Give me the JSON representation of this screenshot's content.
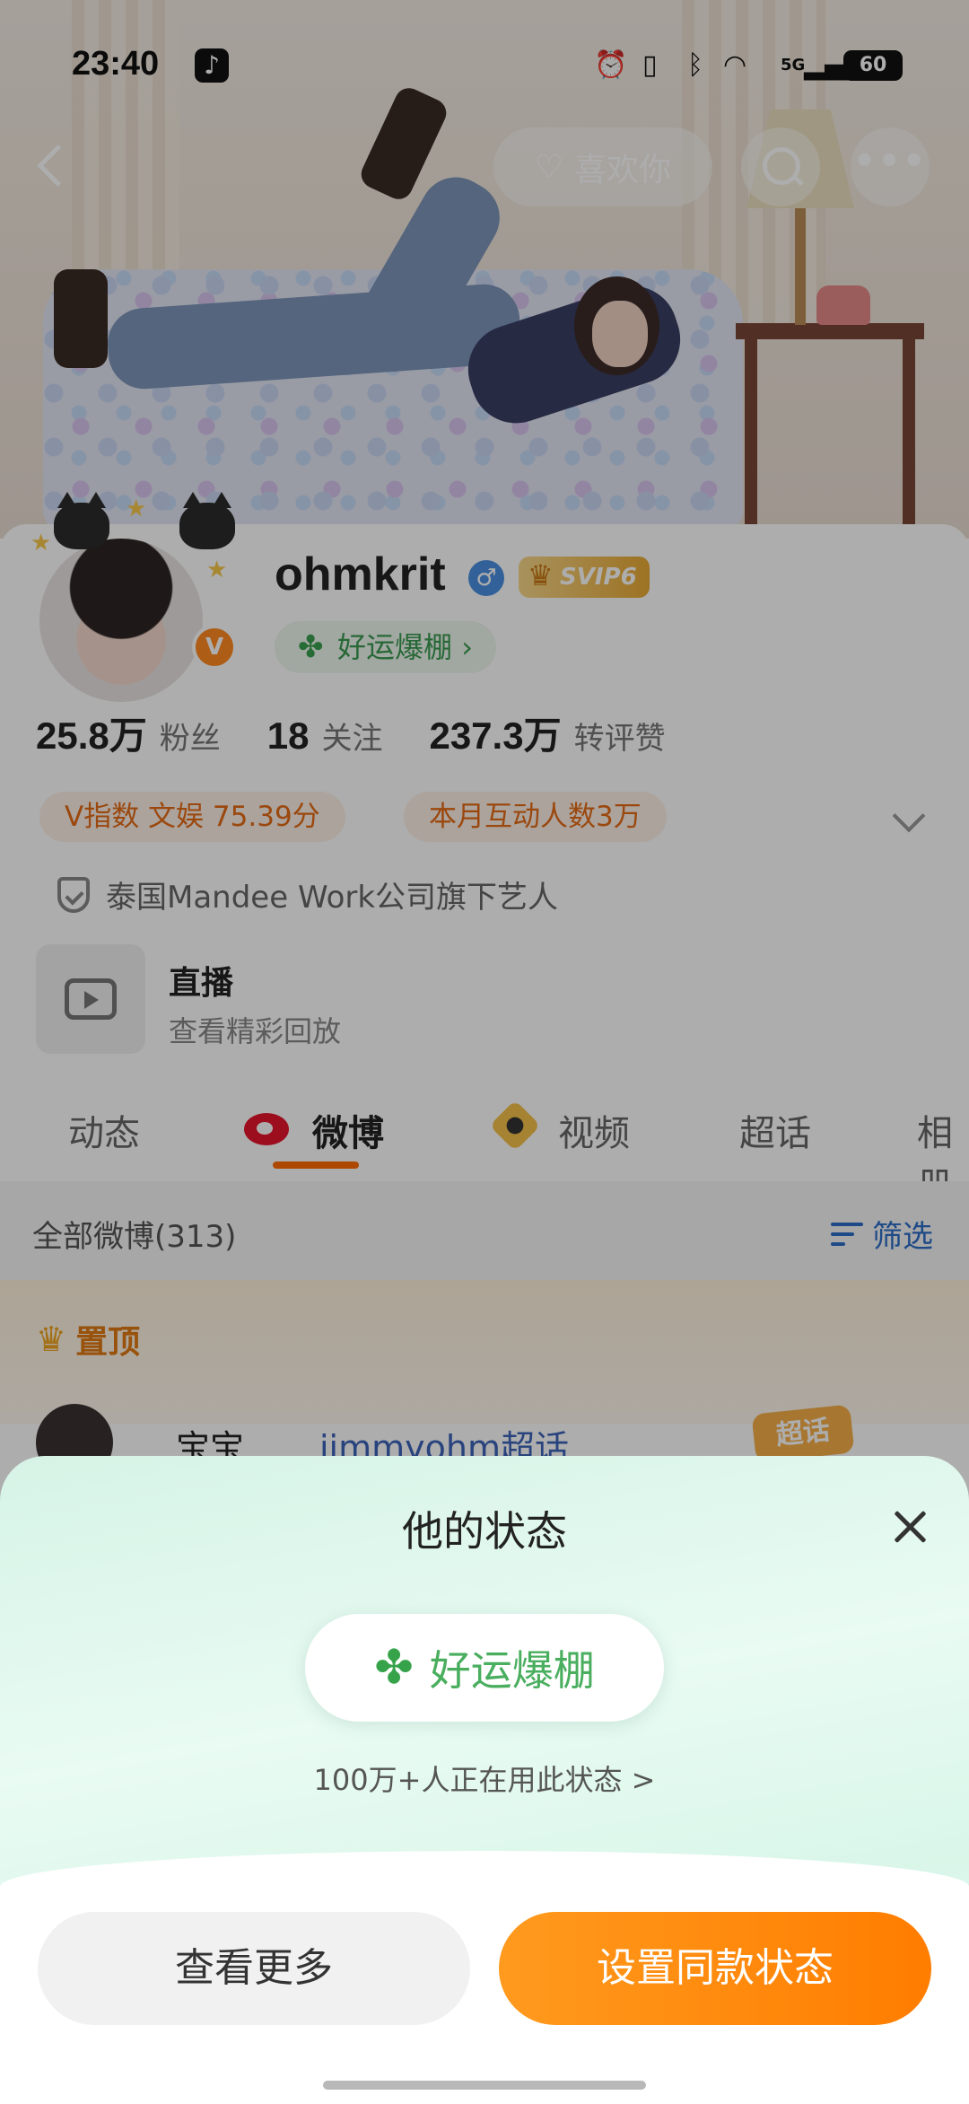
{
  "status_bar": {
    "time": "23:40",
    "network": "5G",
    "battery": "60"
  },
  "nav": {
    "like_label": "喜欢你"
  },
  "profile": {
    "username": "ohmkrit",
    "svip": "SVIP6",
    "v_badge": "V",
    "status_chip": "好运爆棚",
    "stats": [
      {
        "value": "25.8万",
        "label": "粉丝"
      },
      {
        "value": "18",
        "label": "关注"
      },
      {
        "value": "237.3万",
        "label": "转评赞"
      }
    ],
    "pills": [
      "V指数 文娱 75.39分",
      "本月互动人数3万"
    ],
    "company": "泰国Mandee Work公司旗下艺人",
    "live": {
      "title": "直播",
      "subtitle": "查看精彩回放"
    }
  },
  "tabs": [
    "动态",
    "微博",
    "视频",
    "超话",
    "相册"
  ],
  "feed": {
    "filter_left": "全部微博(313)",
    "filter_right": "筛选",
    "pinned_label": "置顶",
    "post_name": "宝宝",
    "post_tag": "jimmyohm超话",
    "badge": "超话"
  },
  "sheet": {
    "title": "他的状态",
    "status_text": "好运爆棚",
    "usage_text": "100万+人正在用此状态 >",
    "btn_more": "查看更多",
    "btn_set": "设置同款状态"
  },
  "colors": {
    "accent": "#ff7d00",
    "status_green": "#4aae5f",
    "link_blue": "#2d6ec8"
  }
}
